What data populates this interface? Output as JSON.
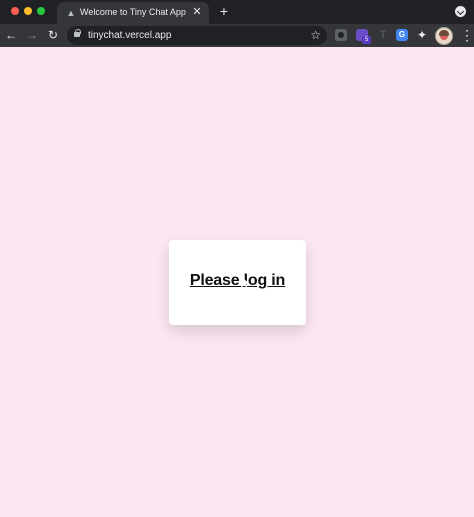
{
  "window": {
    "traffic_lights": [
      "red",
      "yellow",
      "green"
    ]
  },
  "tab": {
    "title": "Welcome to Tiny Chat App",
    "favicon": "triangle-icon",
    "close_label": "✕"
  },
  "toolbar": {
    "new_tab_label": "+",
    "back_label": "←",
    "forward_label": "→",
    "reload_label": "↻",
    "star_label": "☆",
    "menu_label": "⋮"
  },
  "address_bar": {
    "url": "tinychat.vercel.app"
  },
  "extensions": {
    "items": [
      "camera-icon",
      "purple-extension-icon",
      "faded-extension-icon",
      "translate-icon",
      "puzzle-icon"
    ],
    "badge": "5",
    "faded_glyph": "T",
    "translate_glyph": "G",
    "puzzle_glyph": "✦"
  },
  "page": {
    "login_text": "Please log in"
  },
  "colors": {
    "background": "#fbe6f2",
    "card": "#ffffff",
    "chrome": "#202124"
  }
}
